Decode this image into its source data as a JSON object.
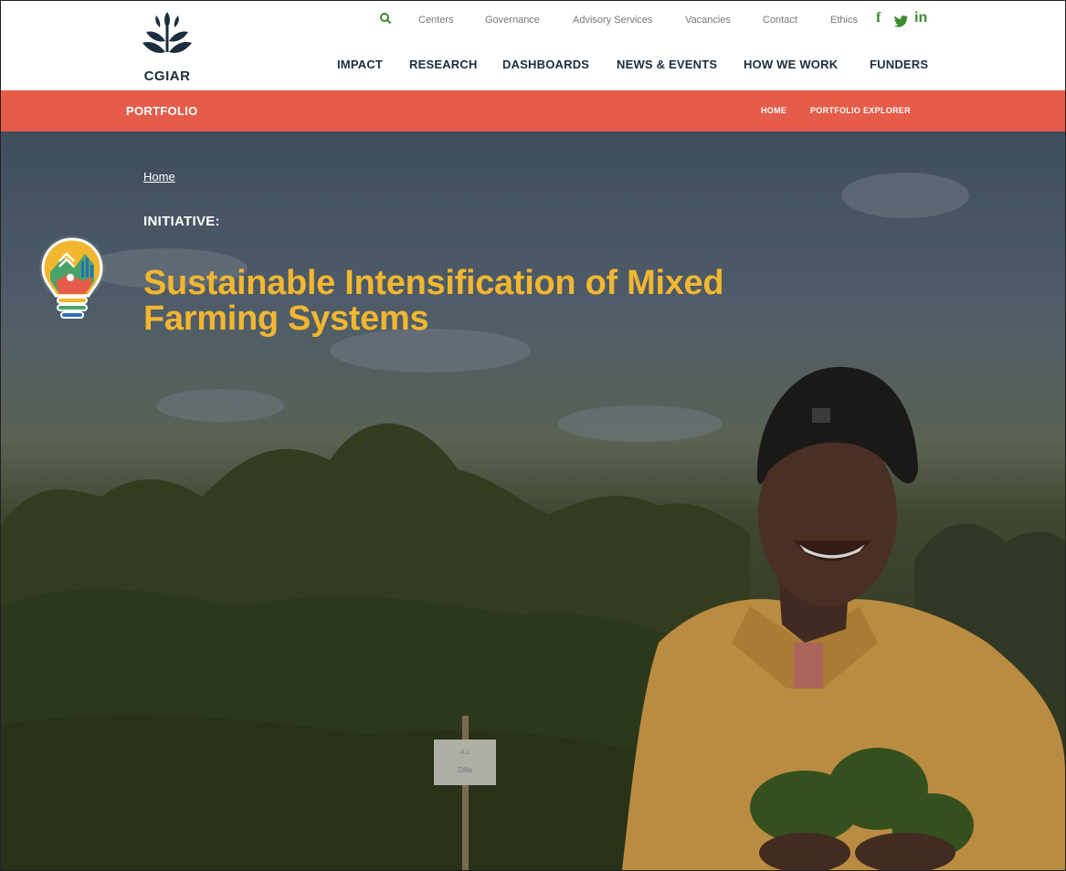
{
  "logo": {
    "text": "CGIAR"
  },
  "utility_nav": {
    "items": [
      "Centers",
      "Governance",
      "Advisory Services",
      "Vacancies",
      "Contact",
      "Ethics"
    ],
    "social": [
      "f",
      "twitter-icon",
      "in"
    ]
  },
  "main_nav": {
    "items": [
      "IMPACT",
      "RESEARCH",
      "DASHBOARDS",
      "NEWS & EVENTS",
      "HOW WE WORK",
      "FUNDERS"
    ]
  },
  "portfolio_bar": {
    "title": "PORTFOLIO",
    "links": [
      "HOME",
      "PORTFOLIO EXPLORER"
    ]
  },
  "hero": {
    "breadcrumb": "Home",
    "kicker": "INITIATIVE:",
    "title_line1": "Sustainable Intensification of Mixed",
    "title_line2": "Farming Systems",
    "sign_line1": "4.1",
    "sign_line2": "Dilla"
  },
  "colors": {
    "accent_bar": "#e65c4a",
    "title_yellow": "#f2b630",
    "nav_dark": "#1c2e3d",
    "social_green": "#3d8b2f"
  }
}
